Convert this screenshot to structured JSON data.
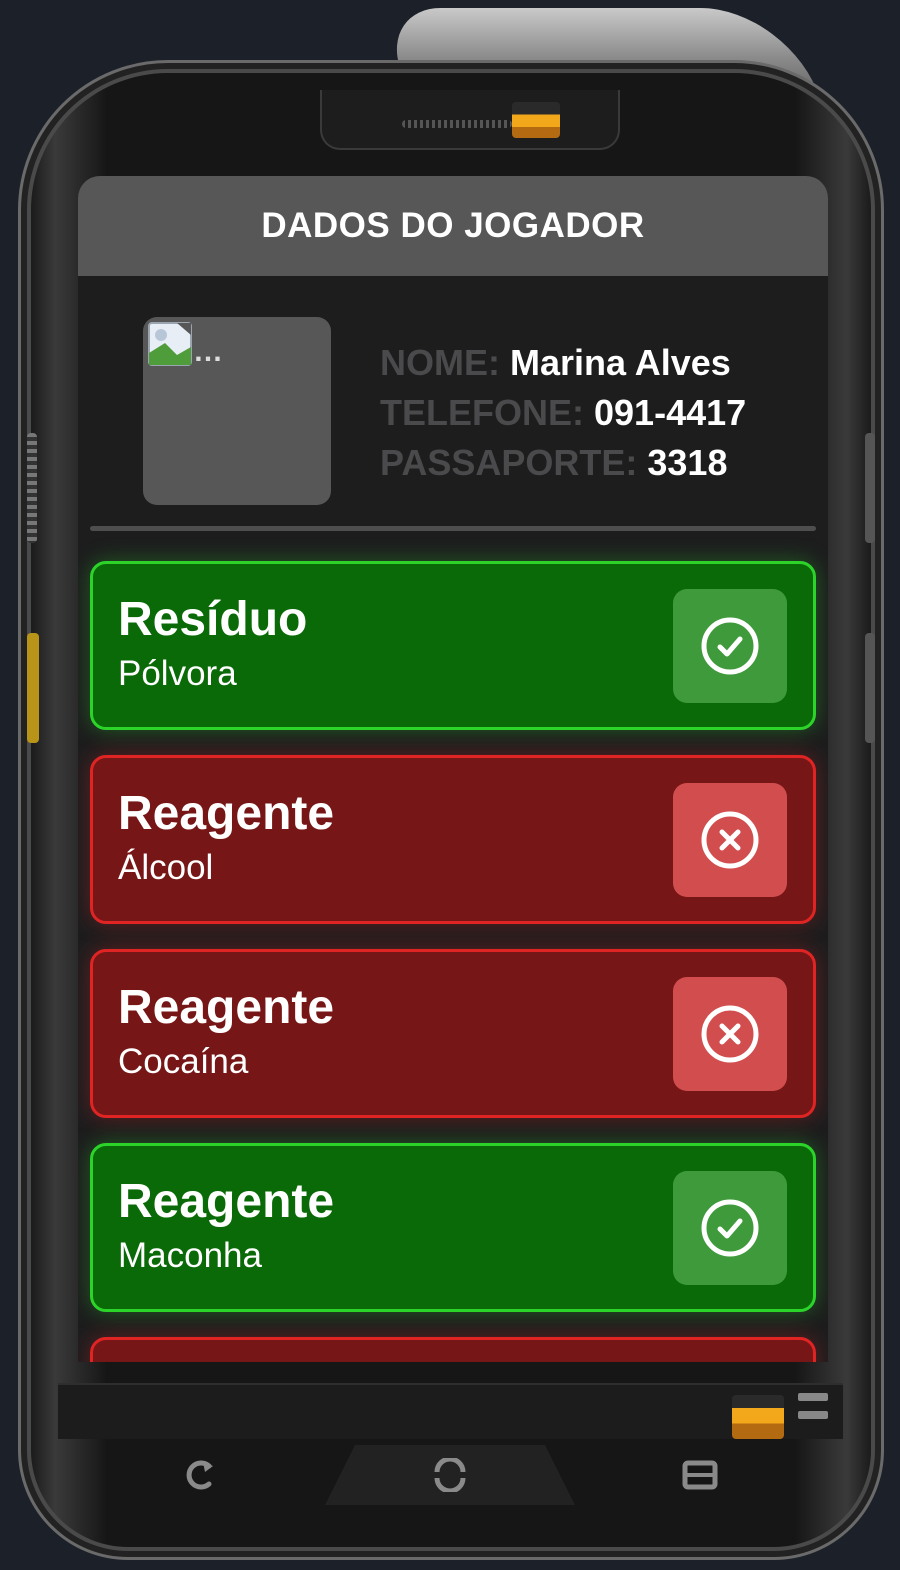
{
  "header": {
    "title": "DADOS DO JOGADOR"
  },
  "profile": {
    "photo_alt": "…",
    "name_label": "NOME:",
    "name_value": "Marina Alves",
    "phone_label": "TELEFONE:",
    "phone_value": "091-4417",
    "passport_label": "PASSAPORTE:",
    "passport_value": "3318"
  },
  "results": [
    {
      "title": "Resíduo",
      "substance": "Pólvora",
      "status": "positive",
      "icon": "check-circle-icon"
    },
    {
      "title": "Reagente",
      "substance": "Álcool",
      "status": "negative",
      "icon": "x-circle-icon"
    },
    {
      "title": "Reagente",
      "substance": "Cocaína",
      "status": "negative",
      "icon": "x-circle-icon"
    },
    {
      "title": "Reagente",
      "substance": "Maconha",
      "status": "positive",
      "icon": "check-circle-icon"
    },
    {
      "title": "",
      "substance": "",
      "status": "negative",
      "icon": "x-circle-icon"
    }
  ],
  "colors": {
    "positive_bg": "#096a07",
    "positive_border": "#2cd42a",
    "negative_bg": "#771616",
    "negative_border": "#e02424",
    "header_bg": "#575757",
    "screen_bg": "#1d1d1e"
  },
  "nav": {
    "icons": [
      "back-icon",
      "home-icon",
      "recent-apps-icon"
    ]
  }
}
